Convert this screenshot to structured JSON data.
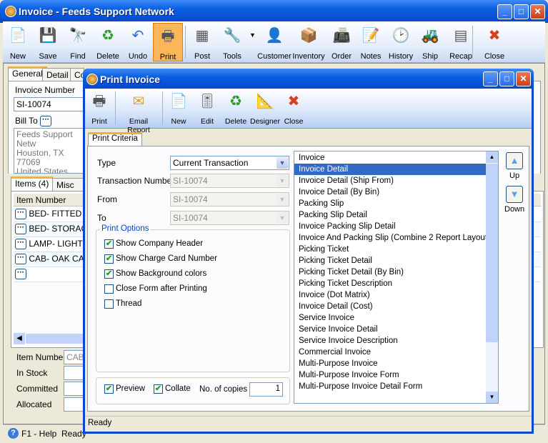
{
  "window": {
    "title": "Invoice - Feeds Support Network"
  },
  "toolbar": [
    {
      "label": "New",
      "icon": "new-icon"
    },
    {
      "label": "Save",
      "icon": "save-icon"
    },
    {
      "label": "Find",
      "icon": "binoculars-icon"
    },
    {
      "label": "Delete",
      "icon": "recycle-bin-icon"
    },
    {
      "label": "Undo",
      "icon": "undo-icon"
    },
    {
      "label": "Print",
      "icon": "printer-icon"
    },
    {
      "label": "Post",
      "icon": "post-icon"
    },
    {
      "label": "Tools",
      "icon": "tools-icon"
    },
    {
      "label": "Customer",
      "icon": "customer-icon"
    },
    {
      "label": "Inventory",
      "icon": "inventory-icon"
    },
    {
      "label": "Order",
      "icon": "order-icon"
    },
    {
      "label": "Notes",
      "icon": "notes-icon"
    },
    {
      "label": "History",
      "icon": "history-icon"
    },
    {
      "label": "Ship",
      "icon": "ship-icon"
    },
    {
      "label": "Recap",
      "icon": "recap-icon"
    },
    {
      "label": "Close",
      "icon": "close-icon"
    }
  ],
  "main": {
    "tabs": [
      "General",
      "Detail",
      "Co"
    ],
    "invoice_number_label": "Invoice Number",
    "invoice_number": "SI-10074",
    "bill_to_label": "Bill To",
    "bill_to_lines": [
      "Feeds Support Netw",
      "Houston, TX 77069",
      "United States"
    ],
    "item_tabs": [
      "Items (4)",
      "Misc Item"
    ],
    "items_header": "Item Number",
    "items": [
      "BED- FITTED SHE",
      "BED- STORAGE",
      "LAMP- LIGHT BLU",
      "CAB- OAK CABIN",
      ""
    ],
    "item_number_label": "Item Number",
    "item_number_value": "CAB-",
    "in_stock_label": "In Stock",
    "committed_label": "Committed",
    "allocated_label": "Allocated"
  },
  "status": {
    "help": "F1 - Help",
    "text": "Ready"
  },
  "dialog": {
    "title": "Print Invoice",
    "toolbar": [
      {
        "label": "Print",
        "icon": "printer-icon"
      },
      {
        "label": "Email Report",
        "icon": "envelope-icon"
      },
      {
        "label": "New",
        "icon": "new-icon"
      },
      {
        "label": "Edit",
        "icon": "edit-icon"
      },
      {
        "label": "Delete",
        "icon": "recycle-bin-icon"
      },
      {
        "label": "Designer",
        "icon": "designer-icon"
      },
      {
        "label": "Close",
        "icon": "close-icon"
      }
    ],
    "tab": "Print Criteria",
    "type_label": "Type",
    "type_value": "Current Transaction",
    "txn_label": "Transaction Number",
    "txn_value": "SI-10074",
    "from_label": "From",
    "from_value": "SI-10074",
    "to_label": "To",
    "to_value": "SI-10074",
    "options_title": "Print Options",
    "options": [
      {
        "label": "Show Company Header",
        "checked": true
      },
      {
        "label": "Show Charge Card Number",
        "checked": true
      },
      {
        "label": "Show Background colors",
        "checked": true
      },
      {
        "label": "Close Form after Printing",
        "checked": false
      },
      {
        "label": "Thread",
        "checked": false
      }
    ],
    "preview_label": "Preview",
    "preview": true,
    "collate_label": "Collate",
    "collate": true,
    "copies_label": "No. of copies",
    "copies": "1",
    "reports": [
      "Invoice",
      "Invoice Detail",
      "Invoice Detail (Ship From)",
      "Invoice Detail (By Bin)",
      "Packing Slip",
      "Packing Slip Detail",
      "Invoice Packing Slip Detail",
      "Invoice And Packing Slip (Combine 2 Report Layout)",
      "Picking Ticket",
      "Picking Ticket Detail",
      "Picking Ticket Detail (By Bin)",
      "Picking Ticket Description",
      "Invoice (Dot Matrix)",
      "Invoice Detail (Cost)",
      "Service Invoice",
      "Service Invoice Detail",
      "Service Invoice Description",
      "Commercial Invoice",
      "Multi-Purpose Invoice",
      "Multi-Purpose Invoice Form",
      "Multi-Purpose Invoice Detail Form"
    ],
    "selected_report": "Invoice Detail",
    "up_label": "Up",
    "down_label": "Down",
    "status": "Ready"
  },
  "colors": {
    "title_blue": "#0a5fe0",
    "selection": "#316ac5",
    "active_tool": "#fbb659"
  }
}
